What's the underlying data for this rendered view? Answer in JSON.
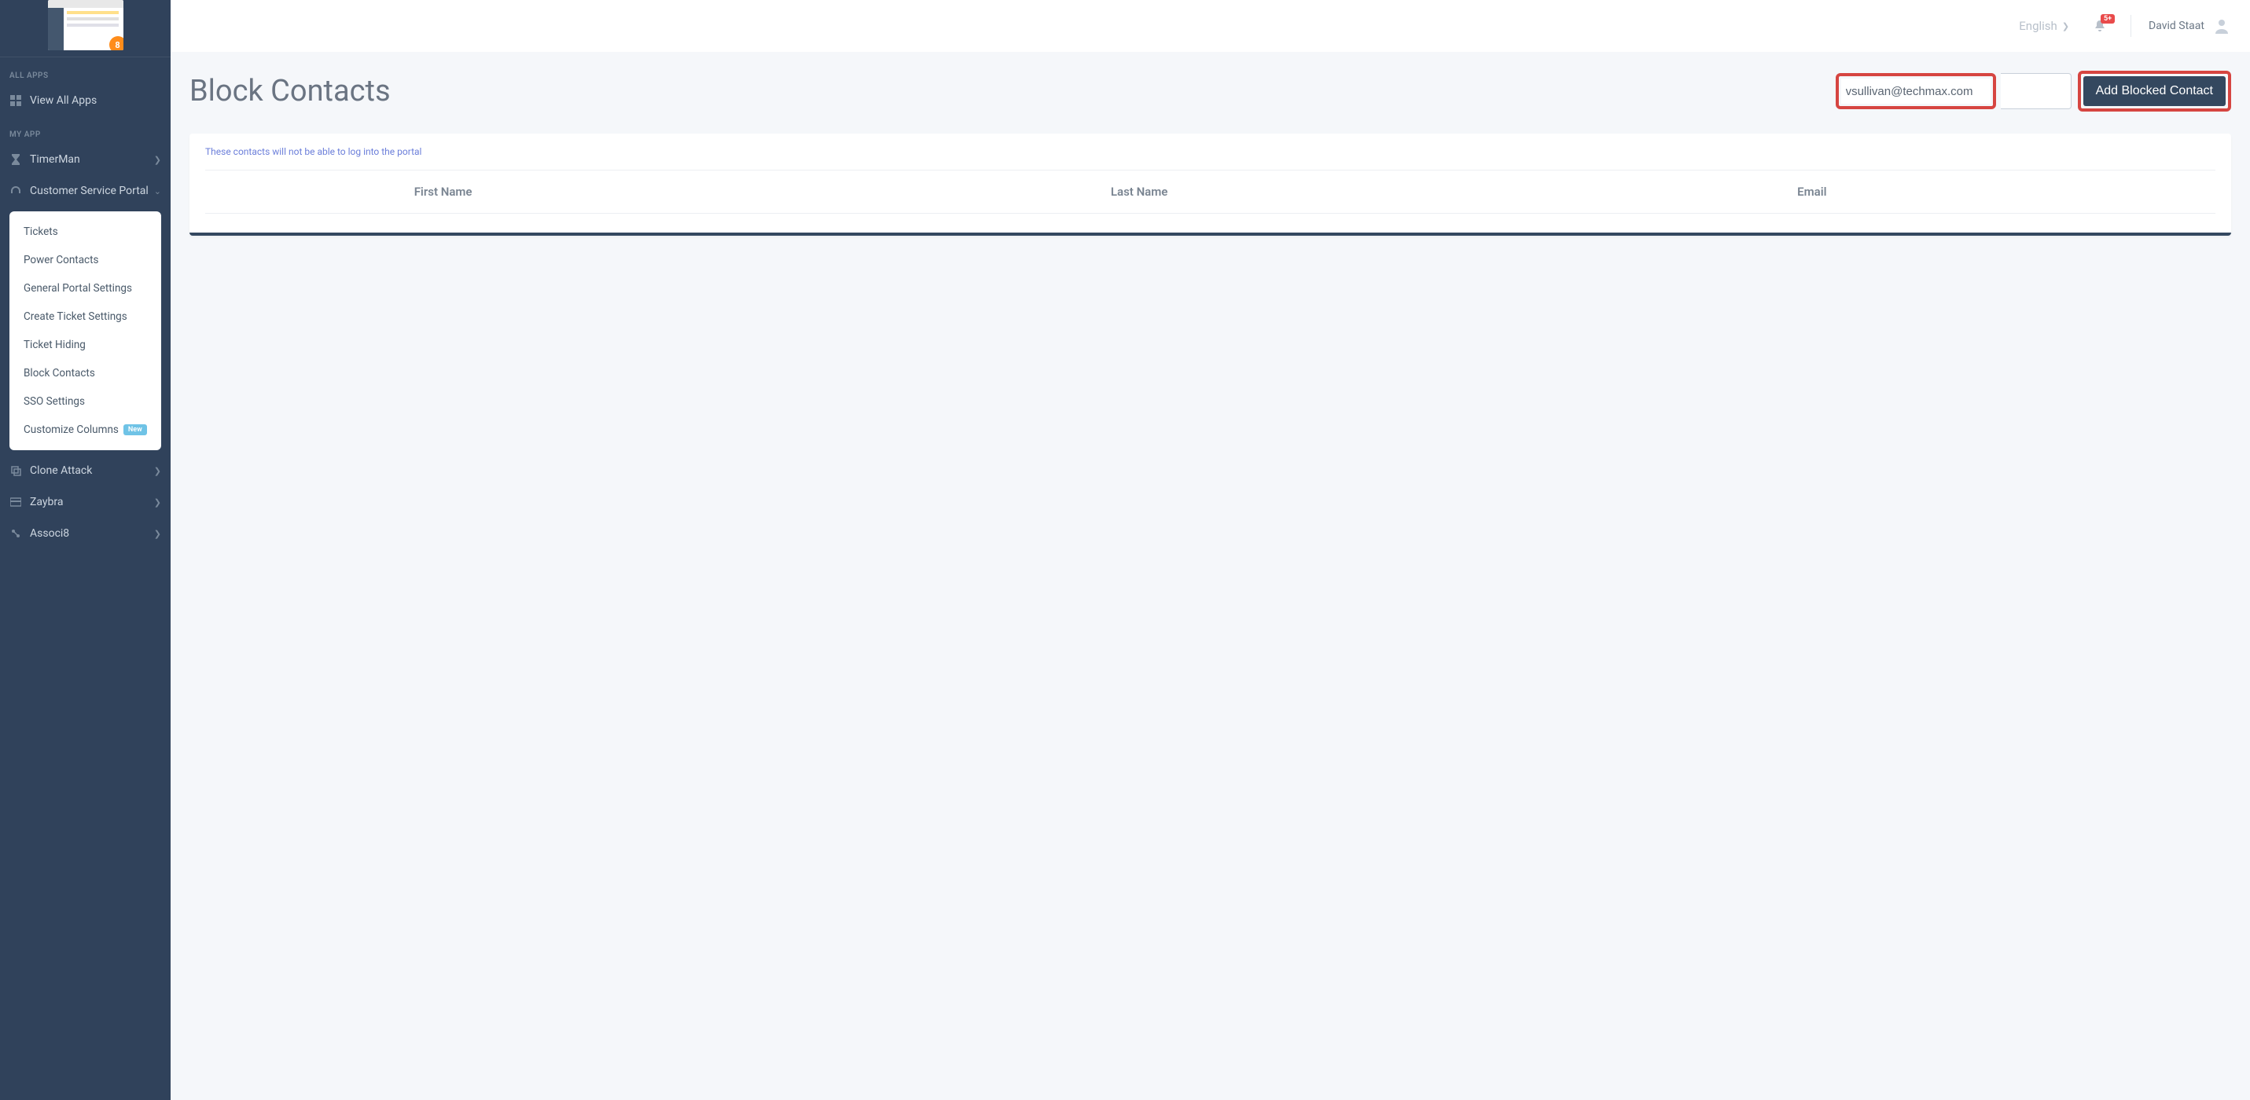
{
  "sidebar": {
    "thumb_badge": "8",
    "heading_all": "ALL APPS",
    "view_all": "View All Apps",
    "heading_my": "MY APP",
    "items": [
      {
        "label": "TimerMan",
        "icon": "hourglass"
      },
      {
        "label": "Customer Service Portal",
        "icon": "headset",
        "expanded": true
      },
      {
        "label": "Clone Attack",
        "icon": "copy"
      },
      {
        "label": "Zaybra",
        "icon": "card"
      },
      {
        "label": "Associ8",
        "icon": "link"
      }
    ],
    "submenu": [
      {
        "label": "Tickets"
      },
      {
        "label": "Power Contacts"
      },
      {
        "label": "General Portal Settings"
      },
      {
        "label": "Create Ticket Settings"
      },
      {
        "label": "Ticket Hiding"
      },
      {
        "label": "Block Contacts"
      },
      {
        "label": "SSO Settings"
      },
      {
        "label": "Customize Columns",
        "badge": "New"
      }
    ]
  },
  "topbar": {
    "language": "English",
    "notif_badge": "5+",
    "user_name": "David Staat"
  },
  "page": {
    "title": "Block Contacts",
    "email_value": "vsullivan@techmax.com",
    "add_button": "Add Blocked Contact",
    "info_text": "These contacts will not be able to log into the portal",
    "columns": {
      "first_name": "First Name",
      "last_name": "Last Name",
      "email": "Email"
    }
  }
}
